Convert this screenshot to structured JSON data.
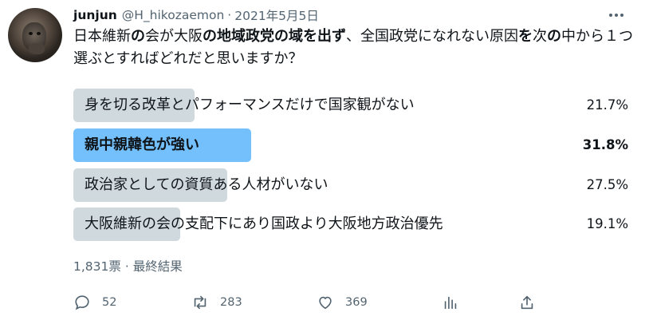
{
  "tweet": {
    "author_name": "junjun",
    "handle": "@H_hikozaemon",
    "separator": "·",
    "date": "2021年5月5日",
    "more_icon": "more-horizontal-icon",
    "text_segments": [
      {
        "text": "日本維新",
        "bold": false
      },
      {
        "text": "の",
        "bold": true
      },
      {
        "text": "会が大阪",
        "bold": false
      },
      {
        "text": "の地域政党の域を出ず",
        "bold": true
      },
      {
        "text": "、全国政党になれない原因",
        "bold": false
      },
      {
        "text": "を",
        "bold": true
      },
      {
        "text": "次",
        "bold": false
      },
      {
        "text": "の",
        "bold": true
      },
      {
        "text": "中から１つ選ぶとすればどれだと思いますか？",
        "bold": false
      }
    ]
  },
  "poll": {
    "options": [
      {
        "label": "身を切る改革とパフォーマンスだけで国家観がない",
        "percent": "21.7%",
        "share": 0.217,
        "winner": false
      },
      {
        "label": "親中親韓色が強い",
        "percent": "31.8%",
        "share": 0.318,
        "winner": true
      },
      {
        "label": "政治家としての資質ある人材がいない",
        "percent": "27.5%",
        "share": 0.275,
        "winner": false
      },
      {
        "label": "大阪維新の会の支配下にあり国政より大阪地方政治優先",
        "percent": "19.1%",
        "share": 0.191,
        "winner": false
      }
    ],
    "votes": "1,831票",
    "separator": "·",
    "status": "最終結果"
  },
  "actions": {
    "reply": {
      "icon": "reply-icon",
      "count": "52"
    },
    "retweet": {
      "icon": "retweet-icon",
      "count": "283"
    },
    "like": {
      "icon": "heart-icon",
      "count": "369"
    },
    "analytics": {
      "icon": "analytics-icon"
    },
    "share": {
      "icon": "share-icon"
    }
  },
  "colors": {
    "bar_default": "#cfd9de",
    "bar_winner": "#74c0fc",
    "text_primary": "#0f1419",
    "text_secondary": "#536471"
  }
}
